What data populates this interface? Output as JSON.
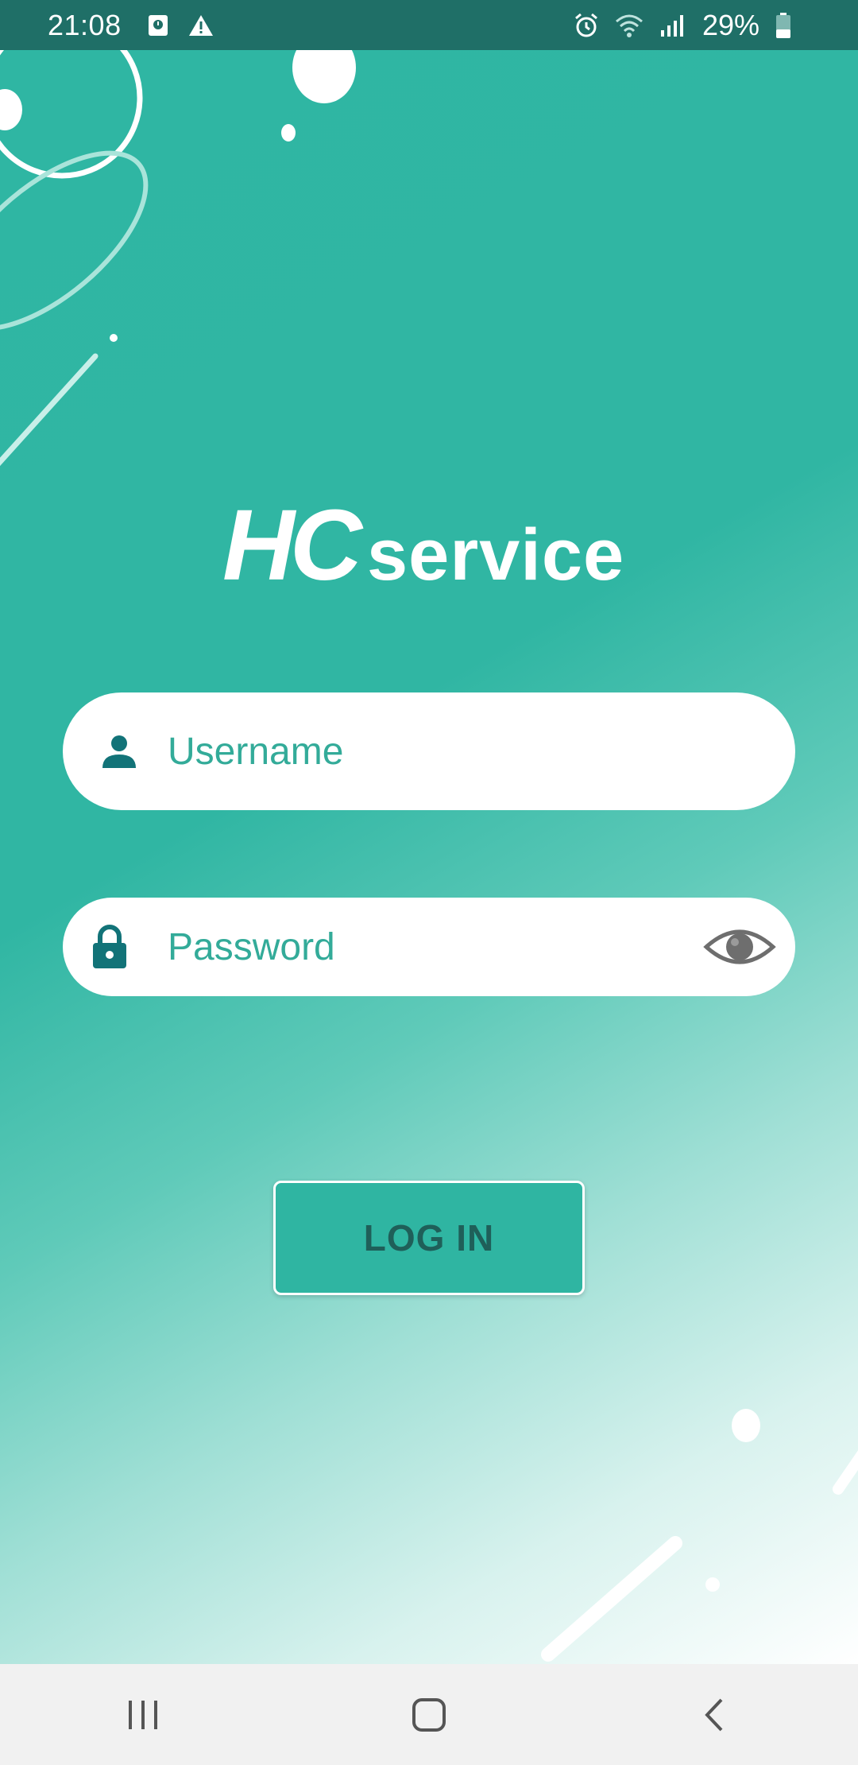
{
  "status_bar": {
    "time": "21:08",
    "battery_percent": "29%",
    "left_icons": [
      "screenshot-icon",
      "warning-icon"
    ],
    "right_icons": [
      "alarm-icon",
      "wifi-icon",
      "signal-icon",
      "battery-icon"
    ]
  },
  "brand": {
    "logo_hc": "HC",
    "logo_service": "service"
  },
  "login_form": {
    "username": {
      "placeholder": "Username",
      "value": "",
      "icon": "person-icon"
    },
    "password": {
      "placeholder": "Password",
      "value": "",
      "icon": "lock-icon",
      "toggle_icon": "eye-icon"
    },
    "login_button_label": "LOG IN"
  },
  "nav_bar": {
    "buttons": [
      "recent-apps-icon",
      "home-icon",
      "back-icon"
    ]
  },
  "colors": {
    "primary": "#2fb5a2",
    "status_bar": "#1f6f67",
    "field_icon": "#127378",
    "placeholder_text": "#33ab99",
    "button_text": "#1f5f59",
    "nav_bar": "#f1f1f1"
  }
}
